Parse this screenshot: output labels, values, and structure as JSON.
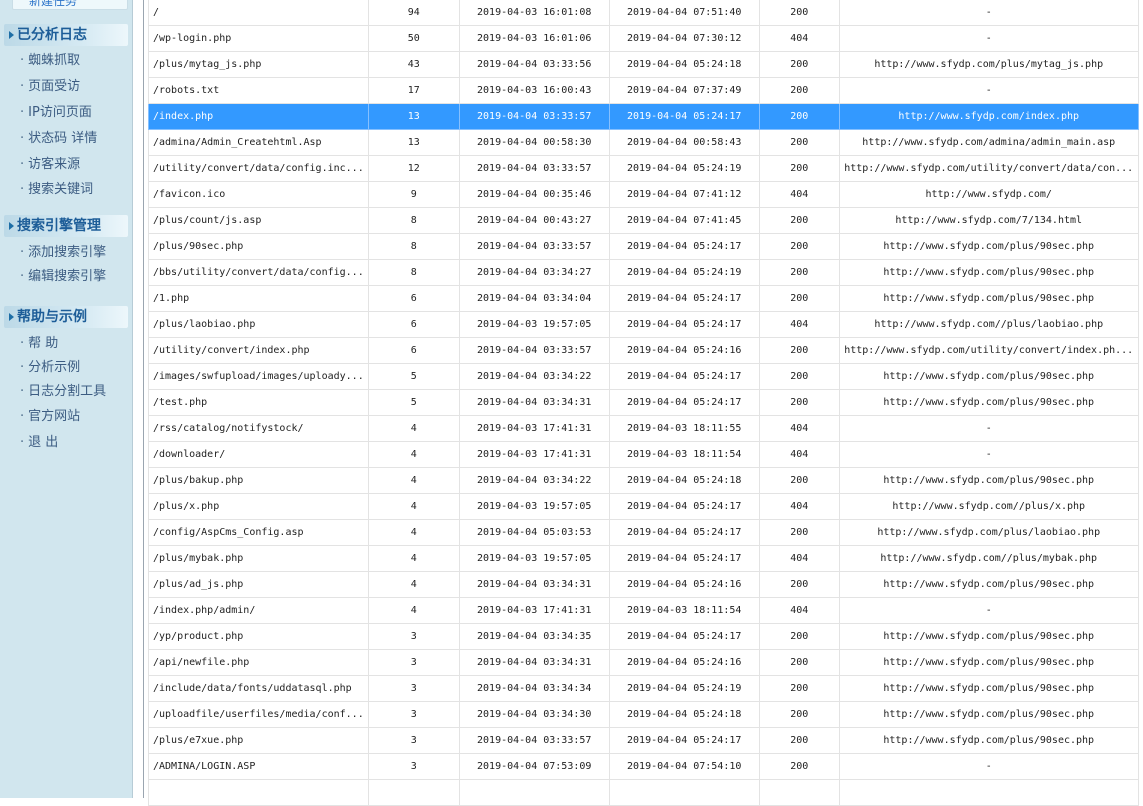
{
  "sidebar": {
    "top_item": "新建任务",
    "sections": [
      {
        "title": "已分析日志",
        "items": [
          "蜘蛛抓取",
          "页面受访",
          "IP访问页面",
          "状态码  详情",
          "访客来源",
          "搜索关键词"
        ]
      },
      {
        "title": "搜索引擎管理",
        "items": [
          "添加搜索引擎",
          "编辑搜索引擎"
        ]
      },
      {
        "title": "帮助与示例",
        "items": [
          "帮  助",
          "分析示例",
          "日志分割工具",
          "官方网站",
          "退  出"
        ]
      }
    ]
  },
  "table": {
    "selected_index": 4,
    "rows": [
      {
        "path": "/",
        "hits": "94",
        "first": "2019-04-03 16:01:08",
        "last": "2019-04-04 07:51:40",
        "code": "200",
        "ref": "-"
      },
      {
        "path": "/wp-login.php",
        "hits": "50",
        "first": "2019-04-03 16:01:06",
        "last": "2019-04-04 07:30:12",
        "code": "404",
        "ref": "-"
      },
      {
        "path": "/plus/mytag_js.php",
        "hits": "43",
        "first": "2019-04-04 03:33:56",
        "last": "2019-04-04 05:24:18",
        "code": "200",
        "ref": "http://www.sfydp.com/plus/mytag_js.php"
      },
      {
        "path": "/robots.txt",
        "hits": "17",
        "first": "2019-04-03 16:00:43",
        "last": "2019-04-04 07:37:49",
        "code": "200",
        "ref": "-"
      },
      {
        "path": "/index.php",
        "hits": "13",
        "first": "2019-04-04 03:33:57",
        "last": "2019-04-04 05:24:17",
        "code": "200",
        "ref": "http://www.sfydp.com/index.php"
      },
      {
        "path": "/admina/Admin_Createhtml.Asp",
        "hits": "13",
        "first": "2019-04-04 00:58:30",
        "last": "2019-04-04 00:58:43",
        "code": "200",
        "ref": "http://www.sfydp.com/admina/admin_main.asp"
      },
      {
        "path": "/utility/convert/data/config.inc...",
        "hits": "12",
        "first": "2019-04-04 03:33:57",
        "last": "2019-04-04 05:24:19",
        "code": "200",
        "ref": "http://www.sfydp.com/utility/convert/data/con..."
      },
      {
        "path": "/favicon.ico",
        "hits": "9",
        "first": "2019-04-04 00:35:46",
        "last": "2019-04-04 07:41:12",
        "code": "404",
        "ref": "http://www.sfydp.com/"
      },
      {
        "path": "/plus/count/js.asp",
        "hits": "8",
        "first": "2019-04-04 00:43:27",
        "last": "2019-04-04 07:41:45",
        "code": "200",
        "ref": "http://www.sfydp.com/7/134.html"
      },
      {
        "path": "/plus/90sec.php",
        "hits": "8",
        "first": "2019-04-04 03:33:57",
        "last": "2019-04-04 05:24:17",
        "code": "200",
        "ref": "http://www.sfydp.com/plus/90sec.php"
      },
      {
        "path": "/bbs/utility/convert/data/config...",
        "hits": "8",
        "first": "2019-04-04 03:34:27",
        "last": "2019-04-04 05:24:19",
        "code": "200",
        "ref": "http://www.sfydp.com/plus/90sec.php"
      },
      {
        "path": "/1.php",
        "hits": "6",
        "first": "2019-04-04 03:34:04",
        "last": "2019-04-04 05:24:17",
        "code": "200",
        "ref": "http://www.sfydp.com/plus/90sec.php"
      },
      {
        "path": "/plus/laobiao.php",
        "hits": "6",
        "first": "2019-04-03 19:57:05",
        "last": "2019-04-04 05:24:17",
        "code": "404",
        "ref": "http://www.sfydp.com//plus/laobiao.php"
      },
      {
        "path": "/utility/convert/index.php",
        "hits": "6",
        "first": "2019-04-04 03:33:57",
        "last": "2019-04-04 05:24:16",
        "code": "200",
        "ref": "http://www.sfydp.com/utility/convert/index.ph..."
      },
      {
        "path": "/images/swfupload/images/uploady...",
        "hits": "5",
        "first": "2019-04-04 03:34:22",
        "last": "2019-04-04 05:24:17",
        "code": "200",
        "ref": "http://www.sfydp.com/plus/90sec.php"
      },
      {
        "path": "/test.php",
        "hits": "5",
        "first": "2019-04-04 03:34:31",
        "last": "2019-04-04 05:24:17",
        "code": "200",
        "ref": "http://www.sfydp.com/plus/90sec.php"
      },
      {
        "path": "/rss/catalog/notifystock/",
        "hits": "4",
        "first": "2019-04-03 17:41:31",
        "last": "2019-04-03 18:11:55",
        "code": "404",
        "ref": "-"
      },
      {
        "path": "/downloader/",
        "hits": "4",
        "first": "2019-04-03 17:41:31",
        "last": "2019-04-03 18:11:54",
        "code": "404",
        "ref": "-"
      },
      {
        "path": "/plus/bakup.php",
        "hits": "4",
        "first": "2019-04-04 03:34:22",
        "last": "2019-04-04 05:24:18",
        "code": "200",
        "ref": "http://www.sfydp.com/plus/90sec.php"
      },
      {
        "path": "/plus/x.php",
        "hits": "4",
        "first": "2019-04-03 19:57:05",
        "last": "2019-04-04 05:24:17",
        "code": "404",
        "ref": "http://www.sfydp.com//plus/x.php"
      },
      {
        "path": "/config/AspCms_Config.asp",
        "hits": "4",
        "first": "2019-04-04 05:03:53",
        "last": "2019-04-04 05:24:17",
        "code": "200",
        "ref": "http://www.sfydp.com/plus/laobiao.php"
      },
      {
        "path": "/plus/mybak.php",
        "hits": "4",
        "first": "2019-04-03 19:57:05",
        "last": "2019-04-04 05:24:17",
        "code": "404",
        "ref": "http://www.sfydp.com//plus/mybak.php"
      },
      {
        "path": "/plus/ad_js.php",
        "hits": "4",
        "first": "2019-04-04 03:34:31",
        "last": "2019-04-04 05:24:16",
        "code": "200",
        "ref": "http://www.sfydp.com/plus/90sec.php"
      },
      {
        "path": "/index.php/admin/",
        "hits": "4",
        "first": "2019-04-03 17:41:31",
        "last": "2019-04-03 18:11:54",
        "code": "404",
        "ref": "-"
      },
      {
        "path": "/yp/product.php",
        "hits": "3",
        "first": "2019-04-04 03:34:35",
        "last": "2019-04-04 05:24:17",
        "code": "200",
        "ref": "http://www.sfydp.com/plus/90sec.php"
      },
      {
        "path": "/api/newfile.php",
        "hits": "3",
        "first": "2019-04-04 03:34:31",
        "last": "2019-04-04 05:24:16",
        "code": "200",
        "ref": "http://www.sfydp.com/plus/90sec.php"
      },
      {
        "path": "/include/data/fonts/uddatasql.php",
        "hits": "3",
        "first": "2019-04-04 03:34:34",
        "last": "2019-04-04 05:24:19",
        "code": "200",
        "ref": "http://www.sfydp.com/plus/90sec.php"
      },
      {
        "path": "/uploadfile/userfiles/media/conf...",
        "hits": "3",
        "first": "2019-04-04 03:34:30",
        "last": "2019-04-04 05:24:18",
        "code": "200",
        "ref": "http://www.sfydp.com/plus/90sec.php"
      },
      {
        "path": "/plus/e7xue.php",
        "hits": "3",
        "first": "2019-04-04 03:33:57",
        "last": "2019-04-04 05:24:17",
        "code": "200",
        "ref": "http://www.sfydp.com/plus/90sec.php"
      },
      {
        "path": "/ADMINA/LOGIN.ASP",
        "hits": "3",
        "first": "2019-04-04 07:53:09",
        "last": "2019-04-04 07:54:10",
        "code": "200",
        "ref": "-"
      },
      {
        "path": "",
        "hits": "",
        "first": "",
        "last": "",
        "code": "",
        "ref": ""
      }
    ]
  }
}
